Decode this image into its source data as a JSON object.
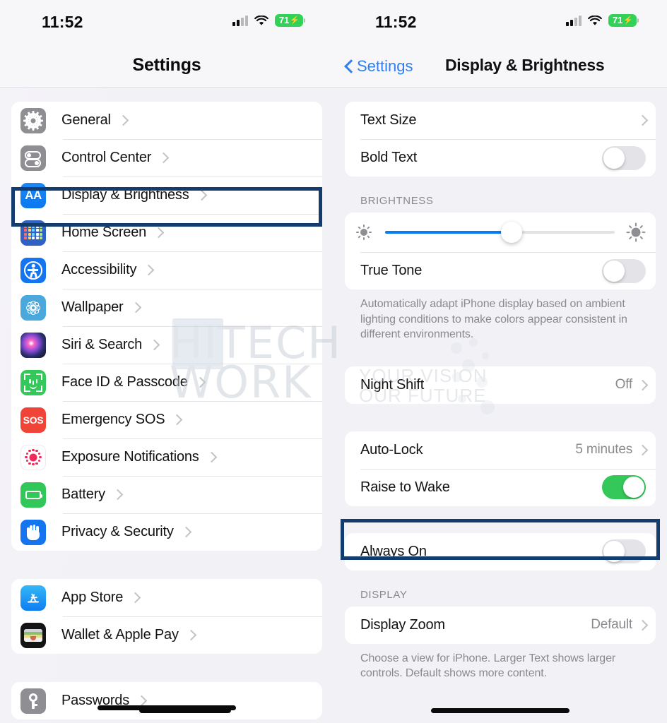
{
  "left_pane": {
    "status_bar": {
      "time": "11:52",
      "battery": "71",
      "charging_glyph": "⚡",
      "cell_icon": "cellular-bars-icon",
      "wifi_icon": "wifi-icon"
    },
    "nav": {
      "title": "Settings"
    },
    "groups": [
      {
        "items": [
          {
            "label": "General",
            "icon": "gear-icon"
          },
          {
            "label": "Control Center",
            "icon": "control-center-icon"
          },
          {
            "label": "Display & Brightness",
            "icon": "display-brightness-icon",
            "icon_text": "AA",
            "highlighted": true
          },
          {
            "label": "Home Screen",
            "icon": "home-screen-icon"
          },
          {
            "label": "Accessibility",
            "icon": "accessibility-icon"
          },
          {
            "label": "Wallpaper",
            "icon": "wallpaper-icon"
          },
          {
            "label": "Siri & Search",
            "icon": "siri-icon"
          },
          {
            "label": "Face ID & Passcode",
            "icon": "face-id-icon"
          },
          {
            "label": "Emergency SOS",
            "icon": "sos-icon",
            "icon_text": "SOS"
          },
          {
            "label": "Exposure Notifications",
            "icon": "exposure-notifications-icon"
          },
          {
            "label": "Battery",
            "icon": "battery-icon"
          },
          {
            "label": "Privacy & Security",
            "icon": "privacy-security-icon"
          }
        ]
      },
      {
        "items": [
          {
            "label": "App Store",
            "icon": "app-store-icon"
          },
          {
            "label": "Wallet & Apple Pay",
            "icon": "wallet-icon"
          }
        ]
      },
      {
        "items": [
          {
            "label": "Passwords",
            "icon": "key-icon"
          }
        ]
      }
    ]
  },
  "right_pane": {
    "status_bar": {
      "time": "11:52",
      "battery": "71",
      "charging_glyph": "⚡",
      "cell_icon": "cellular-bars-icon",
      "wifi_icon": "wifi-icon"
    },
    "nav": {
      "back_label": "Settings",
      "title": "Display & Brightness"
    },
    "text_group": {
      "text_size": {
        "label": "Text Size"
      },
      "bold_text": {
        "label": "Bold Text",
        "value": "off"
      }
    },
    "brightness": {
      "header": "BRIGHTNESS",
      "slider": {
        "name": "brightness-slider",
        "percent": 55,
        "low_icon": "sun-small-icon",
        "high_icon": "sun-large-icon"
      },
      "true_tone": {
        "label": "True Tone",
        "value": "off"
      },
      "footer": "Automatically adapt iPhone display based on ambient lighting conditions to make colors appear consistent in different environments."
    },
    "night_shift": {
      "label": "Night Shift",
      "value": "Off"
    },
    "lock_group": {
      "auto_lock": {
        "label": "Auto-Lock",
        "value": "5 minutes"
      },
      "raise_to_wake": {
        "label": "Raise to Wake",
        "value": "on"
      }
    },
    "always_on": {
      "label": "Always On",
      "value": "off",
      "highlighted": true
    },
    "display": {
      "header": "DISPLAY",
      "display_zoom": {
        "label": "Display Zoom",
        "value": "Default"
      },
      "footer": "Choose a view for iPhone. Larger Text shows larger controls. Default shows more content."
    }
  },
  "watermark": {
    "line1": "HITECH",
    "line2": "WORK",
    "tagline1": "YOUR VISION",
    "tagline2": "OUR FUTURE"
  },
  "colors": {
    "accent_blue": "#0a7cf1",
    "link_blue": "#2f7ff0",
    "toggle_on_green": "#34c759",
    "battery_green": "#32d157",
    "highlight_navy": "#123c6e",
    "page_bg": "#f2f1f6",
    "card_bg": "#ffffff"
  }
}
